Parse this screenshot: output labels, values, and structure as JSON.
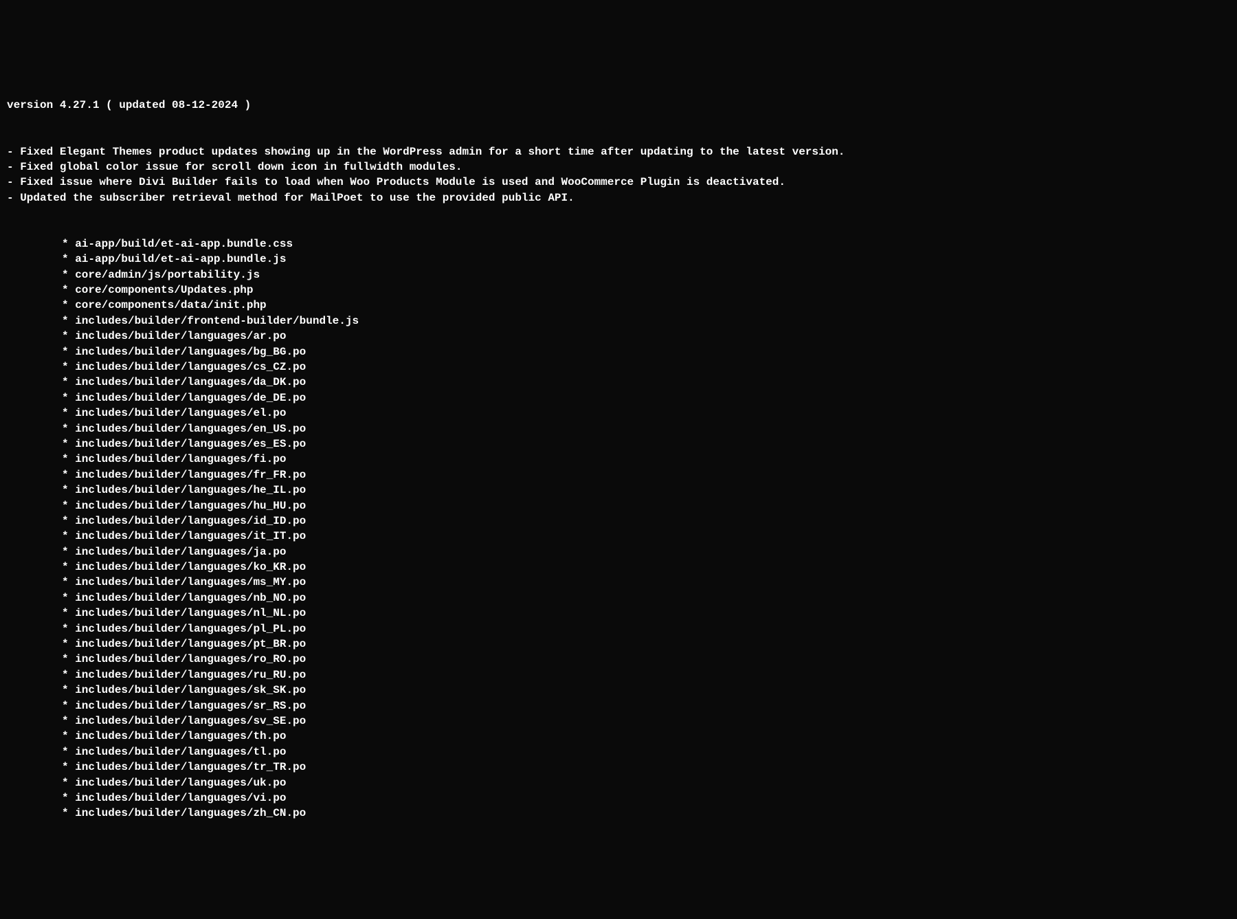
{
  "changelog": {
    "version_line": "version 4.27.1 ( updated 08-12-2024 )",
    "fixes": [
      "- Fixed Elegant Themes product updates showing up in the WordPress admin for a short time after updating to the latest version.",
      "- Fixed global color issue for scroll down icon in fullwidth modules.",
      "- Fixed issue where Divi Builder fails to load when Woo Products Module is used and WooCommerce Plugin is deactivated.",
      "- Updated the subscriber retrieval method for MailPoet to use the provided public API."
    ],
    "files": [
      "ai-app/build/et-ai-app.bundle.css",
      "ai-app/build/et-ai-app.bundle.js",
      "core/admin/js/portability.js",
      "core/components/Updates.php",
      "core/components/data/init.php",
      "includes/builder/frontend-builder/bundle.js",
      "includes/builder/languages/ar.po",
      "includes/builder/languages/bg_BG.po",
      "includes/builder/languages/cs_CZ.po",
      "includes/builder/languages/da_DK.po",
      "includes/builder/languages/de_DE.po",
      "includes/builder/languages/el.po",
      "includes/builder/languages/en_US.po",
      "includes/builder/languages/es_ES.po",
      "includes/builder/languages/fi.po",
      "includes/builder/languages/fr_FR.po",
      "includes/builder/languages/he_IL.po",
      "includes/builder/languages/hu_HU.po",
      "includes/builder/languages/id_ID.po",
      "includes/builder/languages/it_IT.po",
      "includes/builder/languages/ja.po",
      "includes/builder/languages/ko_KR.po",
      "includes/builder/languages/ms_MY.po",
      "includes/builder/languages/nb_NO.po",
      "includes/builder/languages/nl_NL.po",
      "includes/builder/languages/pl_PL.po",
      "includes/builder/languages/pt_BR.po",
      "includes/builder/languages/ro_RO.po",
      "includes/builder/languages/ru_RU.po",
      "includes/builder/languages/sk_SK.po",
      "includes/builder/languages/sr_RS.po",
      "includes/builder/languages/sv_SE.po",
      "includes/builder/languages/th.po",
      "includes/builder/languages/tl.po",
      "includes/builder/languages/tr_TR.po",
      "includes/builder/languages/uk.po",
      "includes/builder/languages/vi.po",
      "includes/builder/languages/zh_CN.po"
    ]
  }
}
